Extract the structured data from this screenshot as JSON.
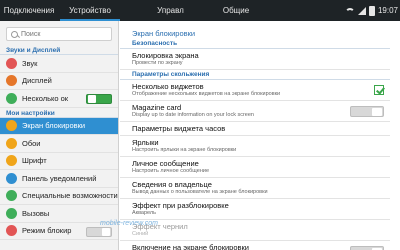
{
  "tabs": [
    {
      "label": "Подключения"
    },
    {
      "label": "Устройство"
    },
    {
      "label": "Управл"
    },
    {
      "label": "Общие"
    }
  ],
  "status": {
    "time": "19:07"
  },
  "sidebar": {
    "search_placeholder": "Поиск",
    "sections": [
      {
        "header": "Звуки и Дисплей",
        "items": [
          {
            "label": "Звук",
            "icon": "speaker-icon",
            "color": "#e25555"
          },
          {
            "label": "Дисплей",
            "icon": "display-icon",
            "color": "#e5762a"
          },
          {
            "label": "Несколько ок",
            "icon": "multiwindow-icon",
            "color": "#3fae5a",
            "toggle": "on"
          }
        ]
      },
      {
        "header": "Мои настройки",
        "items": [
          {
            "label": "Экран блокировки",
            "icon": "lock-screen-icon",
            "color": "#f0a51a",
            "active": true
          },
          {
            "label": "Обои",
            "icon": "wallpaper-icon",
            "color": "#f0a51a"
          },
          {
            "label": "Шрифт",
            "icon": "font-icon",
            "color": "#f0a51a"
          },
          {
            "label": "Панель уведомлений",
            "icon": "notification-icon",
            "color": "#2f8fd1"
          },
          {
            "label": "Специальные возможности",
            "icon": "accessibility-icon",
            "color": "#3fae5a"
          },
          {
            "label": "Вызовы",
            "icon": "phone-icon",
            "color": "#3fae5a"
          },
          {
            "label": "Режим блокир",
            "icon": "block-mode-icon",
            "color": "#e25555",
            "toggle": "off"
          }
        ]
      }
    ]
  },
  "main": {
    "title": "Экран блокировки",
    "sections": [
      {
        "header": "Безопасность",
        "items": [
          {
            "label": "Блокировка экрана",
            "sub": "Провести по экрану"
          }
        ]
      },
      {
        "header": "Параметры скольжения",
        "items": [
          {
            "label": "Несколько виджетов",
            "sub": "Отображение нескольких виджетов на экране блокировки",
            "control": "check"
          },
          {
            "label": "Magazine card",
            "sub": "Display up to date information on your lock screen",
            "control": "toggle"
          },
          {
            "label": "Параметры виджета часов",
            "sub": ""
          },
          {
            "label": "Ярлыки",
            "sub": "Настроить ярлыки на экране блокировки"
          },
          {
            "label": "Личное сообщение",
            "sub": "Настроить личное сообщение"
          },
          {
            "label": "Сведения о владельце",
            "sub": "Вывод данных о пользователе на экране блокировки"
          },
          {
            "label": "Эффект при разблокировке",
            "sub": "Акварель"
          },
          {
            "label": "Эффект чернил",
            "sub": "Синий",
            "dim": true
          },
          {
            "label": "Включение на экране блокировки",
            "sub": "Использовать эффект при разблокировке",
            "control": "toggle"
          }
        ]
      }
    ]
  },
  "watermark": "mobile-review.com"
}
